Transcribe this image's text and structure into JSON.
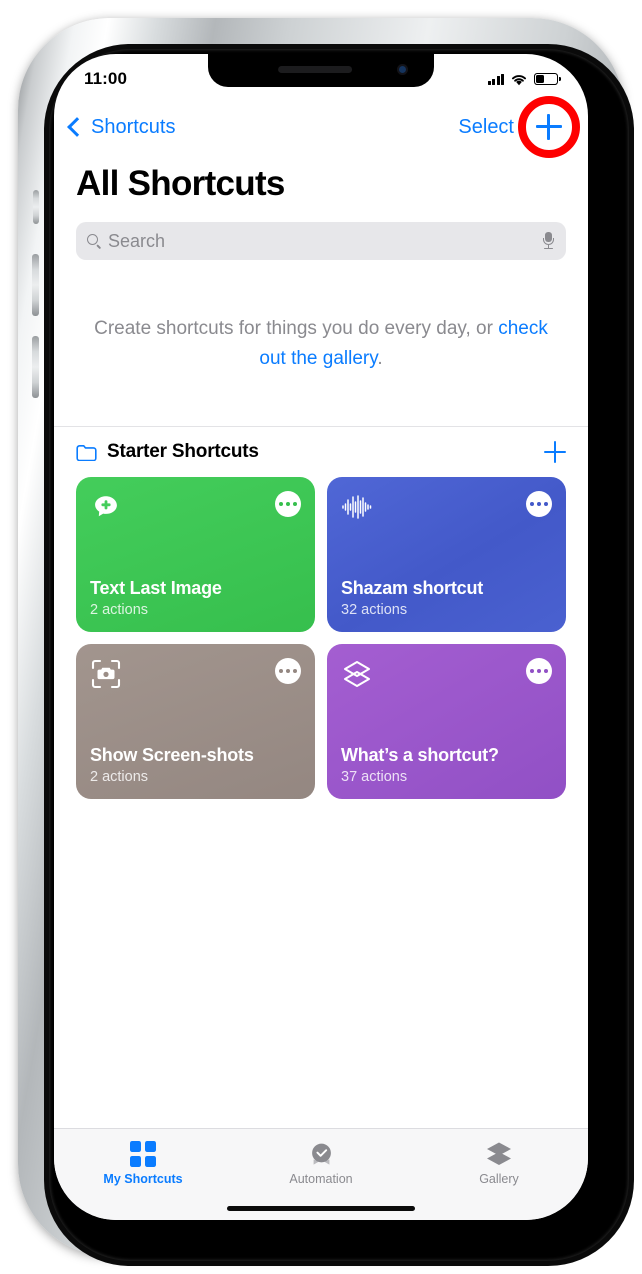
{
  "status_bar": {
    "time": "11:00",
    "signal_icon": "cellular-signal-icon",
    "wifi_icon": "wifi-icon",
    "battery_icon": "battery-icon"
  },
  "nav": {
    "back_label": "Shortcuts",
    "back_icon": "chevron-left-icon",
    "select_label": "Select",
    "add_icon": "plus-icon",
    "highlight_color": "#fe0000",
    "accent_color": "#0a7cff"
  },
  "page": {
    "title": "All Shortcuts"
  },
  "search": {
    "placeholder": "Search",
    "value": "",
    "search_icon": "search-icon",
    "mic_icon": "microphone-icon"
  },
  "empty_state": {
    "text_before": "Create shortcuts for things you do every day, or ",
    "link_text": "check out the gallery",
    "text_after": "."
  },
  "folder_section": {
    "icon": "folder-icon",
    "name": "Starter Shortcuts",
    "add_icon": "plus-icon"
  },
  "shortcuts": [
    {
      "title": "Text Last Image",
      "actions": "2 actions",
      "color": "#41ca58",
      "color_end": "#38c24f",
      "icon": "message-plus-icon",
      "menu_icon": "ellipsis-icon"
    },
    {
      "title": "Shazam shortcut",
      "actions": "32 actions",
      "color": "#4b62cf",
      "color_end": "#3f5ad2",
      "icon": "waveform-icon",
      "menu_icon": "ellipsis-icon"
    },
    {
      "title": "Show Screen-shots",
      "actions": "2 actions",
      "color": "#9d9089",
      "color_end": "#978a83",
      "icon": "camera-viewfinder-icon",
      "menu_icon": "ellipsis-icon"
    },
    {
      "title": "What’s a shortcut?",
      "actions": "37 actions",
      "color": "#9b55c9",
      "color_end": "#8e4cc4",
      "icon": "layers-icon",
      "menu_icon": "ellipsis-icon"
    }
  ],
  "tabs": [
    {
      "label": "My Shortcuts",
      "icon": "grid-squares-icon",
      "active": true
    },
    {
      "label": "Automation",
      "icon": "clock-check-icon",
      "active": false
    },
    {
      "label": "Gallery",
      "icon": "layers-icon",
      "active": false
    }
  ]
}
